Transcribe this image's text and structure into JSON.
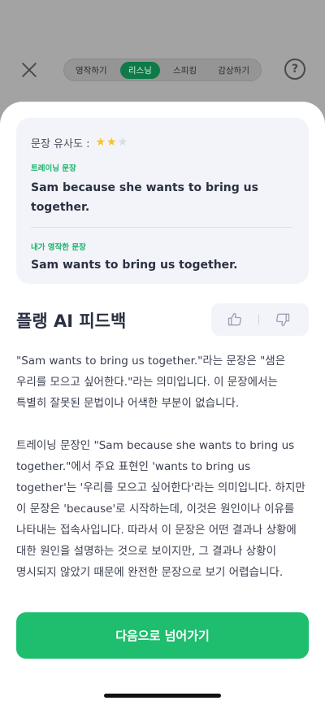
{
  "header": {
    "tabs": [
      {
        "label": "영작하기"
      },
      {
        "label": "리스닝"
      },
      {
        "label": "스피킹"
      },
      {
        "label": "감상하기"
      }
    ],
    "active_tab": "리스닝",
    "help_label": "?",
    "icons": {
      "close": "close-icon",
      "help": "help-icon"
    }
  },
  "compare": {
    "similarity_label": "문장 유사도 :",
    "similarity_stars": 2,
    "similarity_max": 3,
    "training_label": "트레이닝 문장",
    "training_sentence": "Sam because she wants to bring us together.",
    "mine_label": "내가 영작한 문장",
    "mine_sentence": "Sam wants to bring us together."
  },
  "feedback": {
    "title": "플랭 AI 피드백",
    "icons": {
      "like": "thumbs-up-icon",
      "dislike": "thumbs-down-icon"
    },
    "paragraphs": [
      "\"Sam wants to bring us together.\"라는 문장은 \"샘은 우리를 모으고 싶어한다.\"라는 의미입니다. 이 문장에서는 특별히 잘못된 문법이나 어색한 부분이 없습니다.",
      "트레이닝 문장인 \"Sam because she wants to bring us together.\"에서 주요 표현인 'wants to bring us together'는 '우리를 모으고 싶어한다'라는 의미입니다. 하지만 이 문장은 'because'로 시작하는데, 이것은 원인이나 이유를 나타내는 접속사입니다. 따라서 이 문장은 어떤 결과나 상황에 대한 원인을 설명하는 것으로 보이지만, 그 결과나 상황이 명시되지 않았기 때문에 완전한 문장으로 보기 어렵습니다."
    ]
  },
  "next_button_label": "다음으로 넘어가기",
  "colors": {
    "accent_green": "#1fbd6e",
    "label_green": "#1db36b",
    "star_on": "#ffc21a",
    "card_bg": "#f3f4fa"
  }
}
